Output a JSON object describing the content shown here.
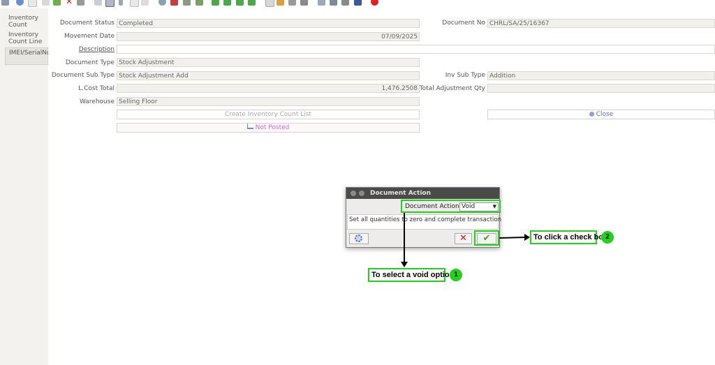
{
  "sidebar": {
    "tabs": [
      {
        "label_1": "Inventory",
        "label_2": "Count"
      },
      {
        "label_1": "Inventory",
        "label_2": "Count Line"
      },
      {
        "label_1": "IMEI/SerialNo"
      }
    ]
  },
  "form": {
    "document_status": {
      "label": "Document Status",
      "value": "Completed"
    },
    "movement_date": {
      "label": "Movement Date",
      "value": "07/09/2025"
    },
    "description": {
      "label": "Description",
      "value": ""
    },
    "document_type": {
      "label": "Document Type",
      "value": "Stock Adjustment"
    },
    "document_sub_type": {
      "label": "Document Sub Type",
      "value": "Stock Adjustment Add"
    },
    "lcost_total": {
      "label": "L.Cost Total",
      "value": "1,476.2508"
    },
    "warehouse": {
      "label": "Warehouse",
      "value": "Selling Floor"
    },
    "document_no": {
      "label": "Document No",
      "value": "CHRL/SA/25/16367"
    },
    "inv_sub_type": {
      "label": "Inv Sub Type",
      "value": "Addition"
    },
    "total_adjustment_qty": {
      "label": "Total Adjustment Qty",
      "value": ""
    },
    "create_list_button": "Create Inventory Count List",
    "not_posted_button": "Not Posted",
    "close_button": "Close"
  },
  "dialog": {
    "title": "Document Action",
    "action_label": "Document Action",
    "action_value": "Void",
    "help_text": "Set all quantities to zero and complete transaction"
  },
  "annotations": {
    "step1_text": "To select a void option",
    "step1_num": "1",
    "step2_text": "To click a check box",
    "step2_num": "2"
  },
  "colors": {
    "highlight": "#22d11a",
    "not_posted": "#e060e0",
    "close": "#5a6fd0"
  }
}
